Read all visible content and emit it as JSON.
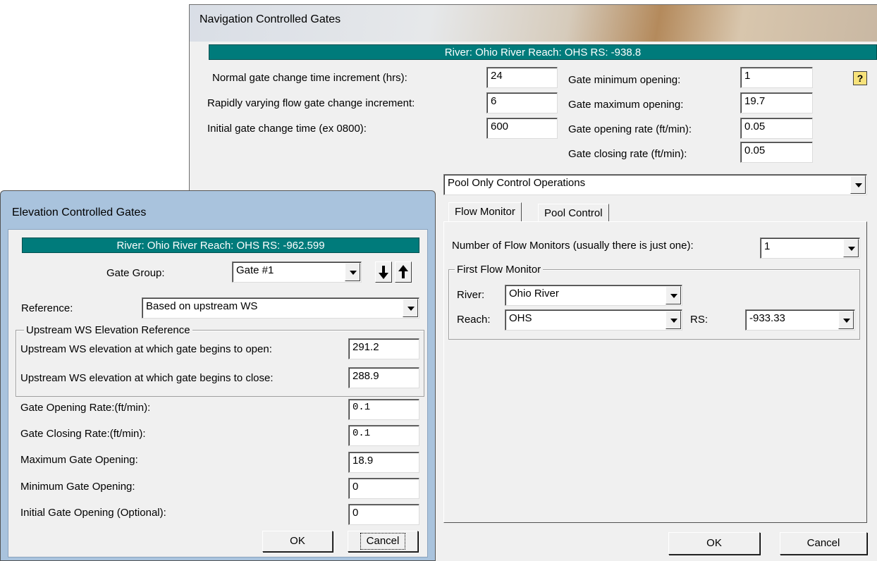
{
  "nav": {
    "title": "Navigation Controlled Gates",
    "header": "River: Ohio River  Reach: OHS  RS: -938.8",
    "help_icon": "?",
    "fields": {
      "normal_label": "Normal gate change time increment (hrs):",
      "normal_value": "24",
      "rapid_label": "Rapidly varying flow gate change increment:",
      "rapid_value": "6",
      "initial_label": "Initial gate change time (ex 0800):",
      "initial_value": "600",
      "min_label": "Gate minimum opening:",
      "min_value": "1",
      "max_label": "Gate maximum opening:",
      "max_value": "19.7",
      "open_rate_label": "Gate opening rate (ft/min):",
      "open_rate_value": "0.05",
      "close_rate_label": "Gate closing rate (ft/min):",
      "close_rate_value": "0.05"
    },
    "operation_mode": "Pool Only Control Operations",
    "tabs": [
      "Flow Monitor",
      "Pool Control"
    ],
    "flow_monitor": {
      "count_label": "Number of Flow Monitors (usually there is just one):",
      "count_value": "1",
      "group_title": "First Flow Monitor",
      "river_label": "River:",
      "river_value": "Ohio River",
      "reach_label": "Reach:",
      "reach_value": "OHS",
      "rs_label": "RS:",
      "rs_value": "-933.33"
    },
    "ok_label": "OK",
    "cancel_label": "Cancel"
  },
  "elev": {
    "title": "Elevation Controlled Gates",
    "header": "River: Ohio River  Reach: OHS  RS: -962.599",
    "gate_group_label": "Gate Group:",
    "gate_group_value": "Gate #1",
    "reference_label": "Reference:",
    "reference_value": "Based on upstream WS",
    "group_title": "Upstream WS Elevation Reference",
    "open_elev_label": "Upstream WS elevation at which gate begins to open:",
    "open_elev_value": "291.2",
    "close_elev_label": "Upstream WS elevation at which gate begins to close:",
    "close_elev_value": "288.9",
    "opening_rate_label": "Gate Opening Rate:(ft/min):",
    "opening_rate_value": "0.1",
    "closing_rate_label": "Gate Closing Rate:(ft/min):",
    "closing_rate_value": "0.1",
    "max_opening_label": "Maximum Gate Opening:",
    "max_opening_value": "18.9",
    "min_opening_label": "Minimum Gate Opening:",
    "min_opening_value": "0",
    "initial_opening_label": "Initial Gate Opening (Optional):",
    "initial_opening_value": "0",
    "ok_label": "OK",
    "cancel_label": "Cancel"
  },
  "colors": {
    "header_bg": "#007b7b",
    "dialog_bg": "#f0f0f0",
    "frame_blue": "#a9c3dd"
  },
  "icons": [
    "help-icon",
    "arrow-down-icon",
    "arrow-up-icon",
    "chevron-down-icon"
  ]
}
